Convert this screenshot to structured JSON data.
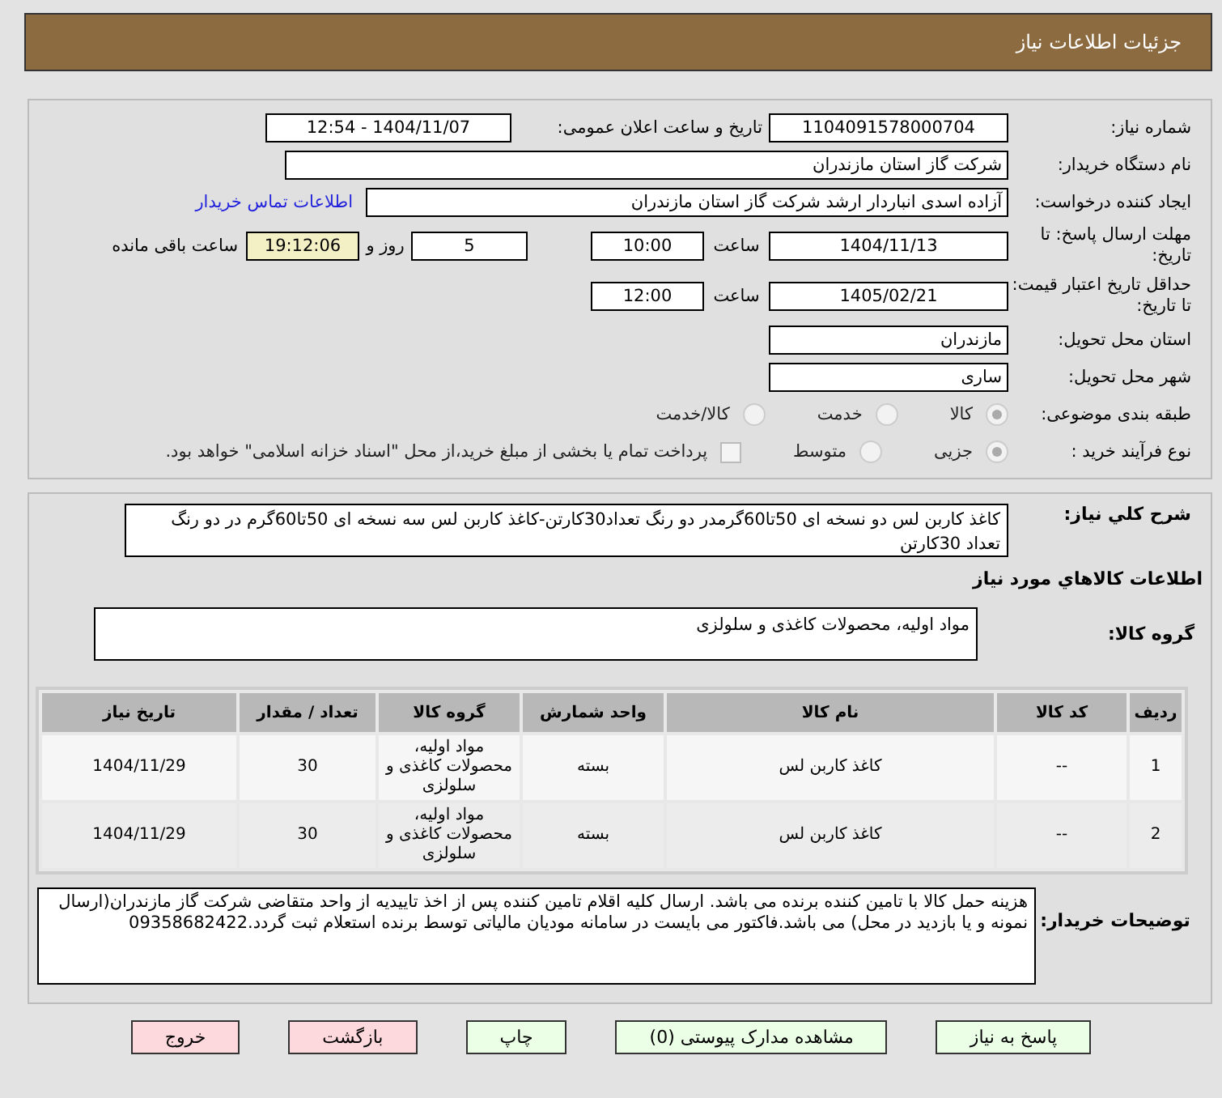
{
  "header": {
    "title": "جزئیات اطلاعات نیاز"
  },
  "need_number": {
    "label": "شماره نیاز:",
    "value": "1104091578000704"
  },
  "announce": {
    "label": "تاریخ و ساعت اعلان عمومی:",
    "value": "1404/11/07 - 12:54"
  },
  "buyer": {
    "label": "نام دستگاه خریدار:",
    "value": "شرکت گاز استان مازندران"
  },
  "requester": {
    "label": "ایجاد کننده درخواست:",
    "value": "آزاده اسدی انباردار ارشد شرکت گاز استان مازندران",
    "link": "اطلاعات تماس خریدار"
  },
  "deadline": {
    "label": "مهلت ارسال پاسخ: تا تاریخ:",
    "date": "1404/11/13",
    "time_label": "ساعت",
    "time": "10:00",
    "days": "5",
    "days_label": "روز و",
    "remaining": "19:12:06",
    "remaining_label": "ساعت باقی مانده"
  },
  "validity": {
    "label": "حداقل تاریخ اعتبار قیمت: تا تاریخ:",
    "date": "1405/02/21",
    "time_label": "ساعت",
    "time": "12:00"
  },
  "province": {
    "label": "استان محل تحویل:",
    "value": "مازندران"
  },
  "city": {
    "label": "شهر محل تحویل:",
    "value": "ساری"
  },
  "category": {
    "label": "طبقه بندی موضوعی:",
    "options": [
      {
        "label": "کالا",
        "selected": true
      },
      {
        "label": "خدمت",
        "selected": false
      },
      {
        "label": "کالا/خدمت",
        "selected": false
      }
    ]
  },
  "purchase_type": {
    "label": "نوع فرآیند خرید :",
    "options": [
      {
        "label": "جزیی",
        "selected": true
      },
      {
        "label": "متوسط",
        "selected": false
      }
    ],
    "checkbox": {
      "label": "پرداخت تمام یا بخشی از مبلغ خرید،از محل \"اسناد خزانه اسلامی\" خواهد بود.",
      "checked": false
    }
  },
  "description": {
    "label": "شرح كلي نياز:",
    "value": "کاغذ کاربن لس دو نسخه ای 50تا60گرمدر دو رنگ تعداد30کارتن-کاغذ کاربن لس سه نسخه ای 50تا60گرم در دو رنگ تعداد 30کارتن"
  },
  "goods_title": "اطلاعات كالاهاي مورد نياز",
  "goods_group": {
    "label": "گروه کالا:",
    "value": "مواد اولیه، محصولات کاغذی و سلولزی"
  },
  "table": {
    "columns": [
      "ردیف",
      "کد کالا",
      "نام کالا",
      "واحد شمارش",
      "گروه کالا",
      "تعداد / مقدار",
      "تاریخ نیاز"
    ],
    "rows": [
      [
        "1",
        "--",
        "کاغذ کاربن لس",
        "بسته",
        "مواد اولیه، محصولات کاغذی و سلولزی",
        "30",
        "1404/11/29"
      ],
      [
        "2",
        "--",
        "کاغذ کاربن لس",
        "بسته",
        "مواد اولیه، محصولات کاغذی و سلولزی",
        "30",
        "1404/11/29"
      ]
    ]
  },
  "notes": {
    "label": "توضیحات خریدار:",
    "value": "هزینه حمل کالا با تامین کننده برنده می باشد. ارسال کلیه اقلام تامین کننده پس از اخذ تاییدیه از واحد متقاضی شرکت گاز مازندران(ارسال نمونه و یا بازدید در محل) می باشد.فاکتور می بایست در سامانه مودیان مالیاتی توسط برنده استعلام ثبت گردد.09358682422"
  },
  "buttons": [
    {
      "label": "پاسخ به نیاز",
      "kind": "primary"
    },
    {
      "label": "مشاهده مدارک پیوستی (0)",
      "kind": "primary"
    },
    {
      "label": "چاپ",
      "kind": "primary"
    },
    {
      "label": "بازگشت",
      "kind": "danger"
    },
    {
      "label": "خروج",
      "kind": "danger"
    }
  ]
}
